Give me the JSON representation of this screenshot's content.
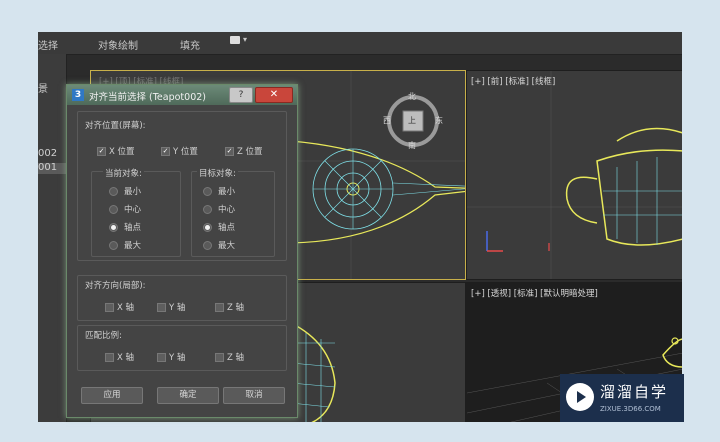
{
  "menubar": {
    "items": [
      "选择",
      "对象绘制",
      "填充"
    ]
  },
  "left_panel": {
    "items": [
      "景",
      "002",
      "001"
    ]
  },
  "viewports": {
    "top_left_label": "[+] [顶] [标准] [线框]",
    "front_label": "[+] [前] [标准] [线框]",
    "perspective_label": "[+] [透视] [标准] [默认明暗处理]",
    "viewcube": {
      "top": "北",
      "left": "西",
      "right": "东",
      "bottom": "南",
      "face": "上"
    }
  },
  "dialog": {
    "title": "对齐当前选择 (Teapot002)",
    "help": "?",
    "close": "✕",
    "position_group": "对齐位置(屏幕):",
    "checks": [
      {
        "label": "X 位置",
        "checked": true
      },
      {
        "label": "Y 位置",
        "checked": true
      },
      {
        "label": "Z 位置",
        "checked": true
      }
    ],
    "current_object": {
      "title": "当前对象:",
      "options": [
        "最小",
        "中心",
        "轴点",
        "最大"
      ],
      "selected": "轴点"
    },
    "target_object": {
      "title": "目标对象:",
      "options": [
        "最小",
        "中心",
        "轴点",
        "最大"
      ],
      "selected": "轴点"
    },
    "orientation_group": "对齐方向(局部):",
    "orientation_axes": [
      "X 轴",
      "Y 轴",
      "Z 轴"
    ],
    "scale_group": "匹配比例:",
    "scale_axes": [
      "X 轴",
      "Y 轴",
      "Z 轴"
    ],
    "buttons": {
      "apply": "应用",
      "ok": "确定",
      "cancel": "取消"
    }
  },
  "watermark": {
    "brand": "溜溜自学",
    "url": "ZIXUE.3D66.COM"
  },
  "colors": {
    "wire_yellow": "#e8e85a",
    "wire_cyan": "#7fe0e8",
    "accent_green": "#6a8a6a",
    "watermark_bg": "#1c2f4c"
  }
}
